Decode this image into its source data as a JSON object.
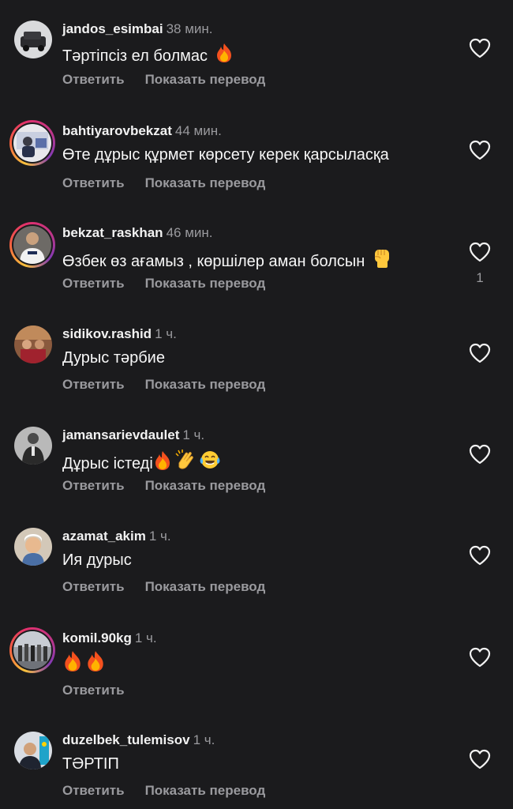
{
  "actions": {
    "reply_label": "Ответить",
    "translate_label": "Показать перевод"
  },
  "comments": [
    {
      "username": "jandos_esimbai",
      "time": "38 мин.",
      "text": "Тәртіпсіз ел болмас",
      "emoji": [
        "fire"
      ],
      "likes": "",
      "story_ring": false
    },
    {
      "username": "bahtiyarovbekzat",
      "time": "44 мин.",
      "text": "Өте дұрыс құрмет көрсету керек қарсыласқа",
      "emoji": [],
      "likes": "",
      "story_ring": true
    },
    {
      "username": "bekzat_raskhan",
      "time": "46 мин.",
      "text": "Өзбек өз ағамыз , көршілер аман болсын",
      "emoji": [
        "raised-fist"
      ],
      "likes": "1",
      "story_ring": true
    },
    {
      "username": "sidikov.rashid",
      "time": "1 ч.",
      "text": "Дурыс тәрбие",
      "emoji": [],
      "likes": "",
      "story_ring": false
    },
    {
      "username": "jamansarievdaulet",
      "time": "1 ч.",
      "text": "Дұрыс істеді",
      "emoji": [
        "fire",
        "clap",
        "laugh-cry"
      ],
      "likes": "",
      "story_ring": false
    },
    {
      "username": "azamat_akim",
      "time": "1 ч.",
      "text": "Ия дурыс",
      "emoji": [],
      "likes": "",
      "story_ring": false
    },
    {
      "username": "komil.90kg",
      "time": "1 ч.",
      "text": "",
      "emoji": [
        "fire",
        "fire"
      ],
      "likes": "",
      "story_ring": true
    },
    {
      "username": "duzelbek_tulemisov",
      "time": "1 ч.",
      "text": "ТӘРТІП",
      "emoji": [],
      "likes": "",
      "story_ring": false
    }
  ],
  "colors": {
    "background": "#1b1b1d",
    "secondary_text": "#9a9a9e",
    "primary_text": "#f5f5f5"
  }
}
